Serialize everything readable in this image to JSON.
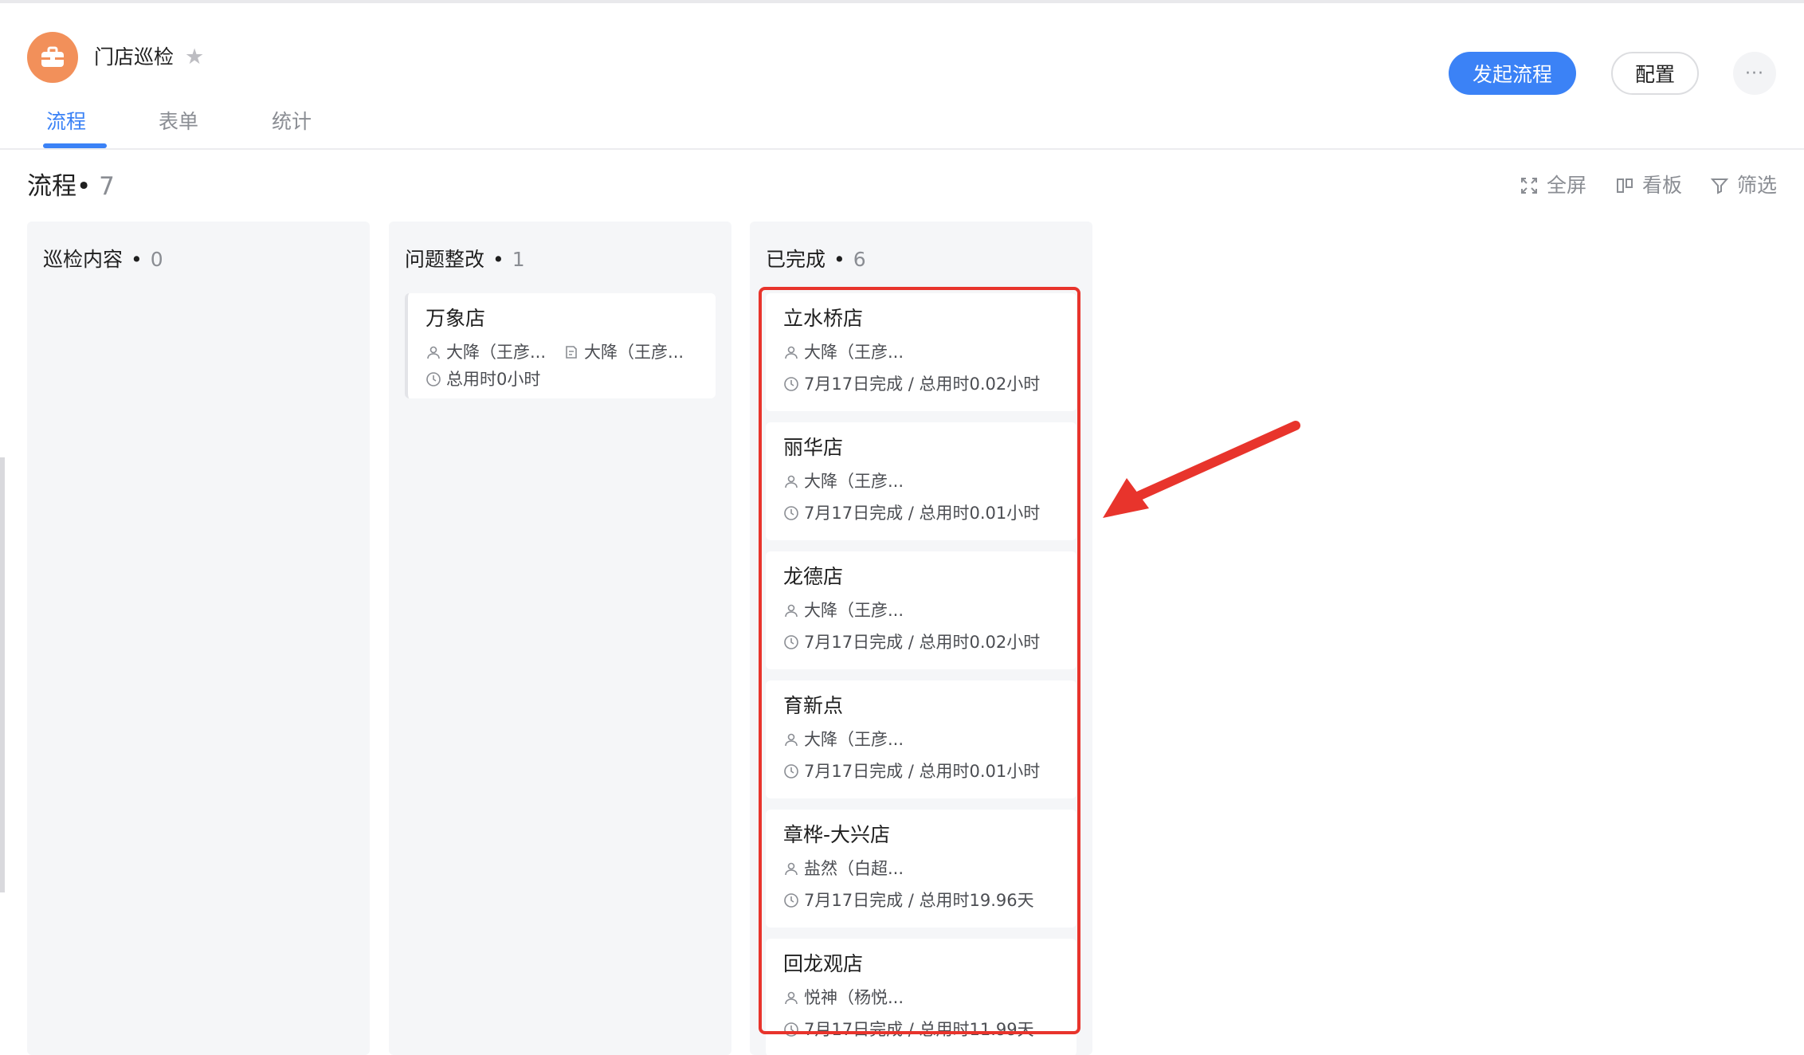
{
  "app": {
    "title": "门店巡检",
    "icon": "briefcase-icon",
    "accent": "#f2905a"
  },
  "header": {
    "primary_button": "发起流程",
    "config_button": "配置",
    "more_button": "···"
  },
  "tabs": [
    {
      "label": "流程",
      "active": true
    },
    {
      "label": "表单",
      "active": false
    },
    {
      "label": "统计",
      "active": false
    }
  ],
  "section": {
    "title": "流程",
    "dot": "•",
    "count": "7"
  },
  "toolbar": {
    "fullscreen": "全屏",
    "board": "看板",
    "filter": "筛选"
  },
  "columns": [
    {
      "title": "巡检内容",
      "count": "0",
      "cards": []
    },
    {
      "title": "问题整改",
      "count": "1",
      "cards": [
        {
          "title": "万象店",
          "assignee": "大降（王彦...",
          "handler": "大降（王彦...",
          "time": "总用时0小时"
        }
      ]
    },
    {
      "title": "已完成",
      "count": "6",
      "cards": [
        {
          "title": "立水桥店",
          "assignee": "大降（王彦...",
          "time": "7月17日完成 / 总用时0.02小时"
        },
        {
          "title": "丽华店",
          "assignee": "大降（王彦...",
          "time": "7月17日完成 / 总用时0.01小时"
        },
        {
          "title": "龙德店",
          "assignee": "大降（王彦...",
          "time": "7月17日完成 / 总用时0.02小时"
        },
        {
          "title": "育新点",
          "assignee": "大降（王彦...",
          "time": "7月17日完成 / 总用时0.01小时"
        },
        {
          "title": "章桦-大兴店",
          "assignee": "盐然（白超...",
          "time": "7月17日完成 / 总用时19.96天"
        },
        {
          "title": "回龙观店",
          "assignee": "悦神（杨悦...",
          "time": "7月17日完成 / 总用时11.99天"
        }
      ]
    }
  ],
  "colors": {
    "primary": "#3b82f6",
    "highlight": "#e8342c",
    "column_bg": "#f5f6f8"
  }
}
